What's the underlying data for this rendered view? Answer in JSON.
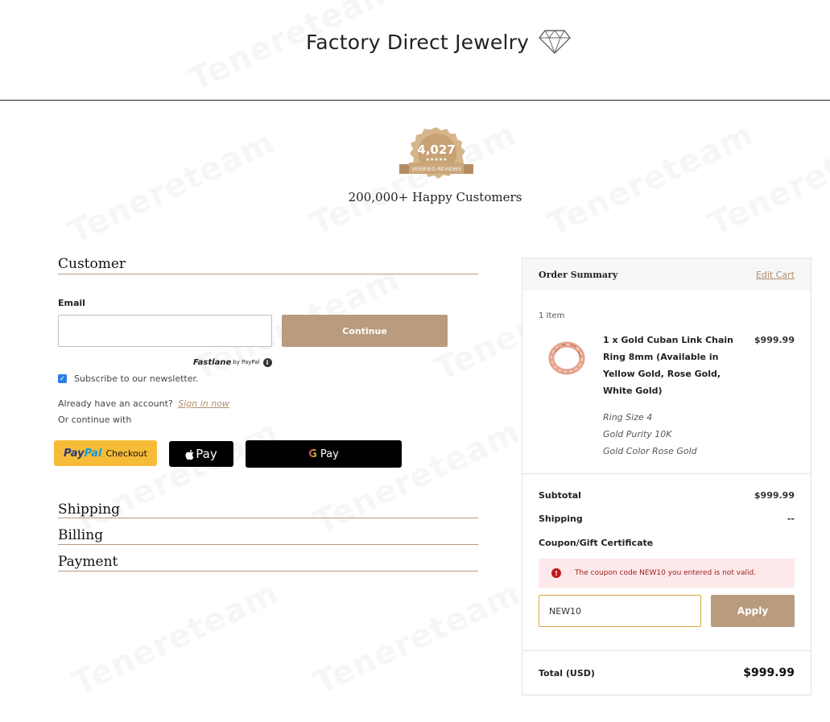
{
  "header": {
    "store_name": "Factory Direct Jewelry",
    "logo_icon": "diamond-icon"
  },
  "badge": {
    "count": "4,027",
    "stars": "★★★★★",
    "text": "VERIFIED REVIEWS"
  },
  "tagline": "200,000+ Happy Customers",
  "watermark_text": "Tenereteam",
  "customer": {
    "title": "Customer",
    "email_label": "Email",
    "email_value": "",
    "continue_label": "Continue",
    "fastlane_label": "Fastlane",
    "fastlane_by": "by PayPal",
    "subscribe_label": "Subscribe to our newsletter.",
    "subscribe_checked": true,
    "account_text": "Already have an account?",
    "sign_in_label": "Sign in now",
    "continue_with": "Or continue with",
    "paypal_label_a": "Pay",
    "paypal_label_b": "Pal",
    "paypal_checkout": "Checkout",
    "applepay_label": "Pay",
    "gpay_g": "G",
    "gpay_label": "Pay"
  },
  "sections": {
    "shipping": "Shipping",
    "billing": "Billing",
    "payment": "Payment"
  },
  "summary": {
    "title": "Order Summary",
    "edit_cart": "Edit Cart",
    "item_count": "1 Item",
    "item": {
      "name": "1 x Gold Cuban Link Chain Ring 8mm (Available in Yellow Gold, Rose Gold, White Gold)",
      "price": "$999.99",
      "options": [
        "Ring Size 4",
        "Gold Purity 10K",
        "Gold Color Rose Gold"
      ]
    },
    "subtotal_label": "Subtotal",
    "subtotal_value": "$999.99",
    "shipping_label": "Shipping",
    "shipping_value": "--",
    "coupon_label": "Coupon/Gift Certificate",
    "alert_text": "The coupon code NEW10 you entered is not valid.",
    "coupon_value": "NEW10",
    "apply_label": "Apply",
    "total_label": "Total (USD)",
    "total_value": "$999.99"
  },
  "colors": {
    "accent": "#b99b7d",
    "link": "#b08d6a",
    "alert_bg": "#fde8ea",
    "alert_text": "#9b1d1d",
    "paypal_yellow": "#f7bc37"
  }
}
